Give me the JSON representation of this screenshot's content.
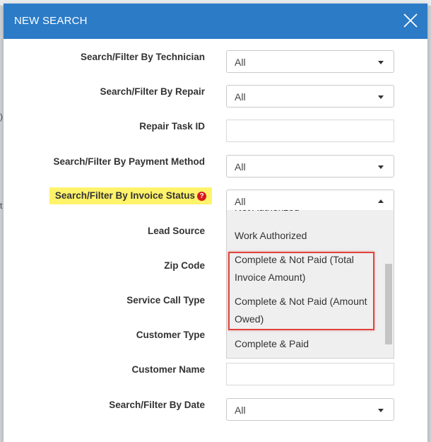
{
  "background": {
    "left_chars": [
      "):",
      "t"
    ]
  },
  "modal": {
    "title": "NEW SEARCH",
    "accent": "#2b7bc6"
  },
  "fields": [
    {
      "label": "Search/Filter By Technician",
      "type": "select",
      "value": "All"
    },
    {
      "label": "Search/Filter By Repair",
      "type": "select",
      "value": "All"
    },
    {
      "label": "Repair Task ID",
      "type": "input",
      "value": ""
    },
    {
      "label": "Search/Filter By Payment Method",
      "type": "select",
      "value": "All"
    },
    {
      "label": "Search/Filter By Invoice Status",
      "type": "select",
      "value": "All",
      "highlighted": true,
      "open": true,
      "help_icon": "question-icon"
    },
    {
      "label": "Lead Source"
    },
    {
      "label": "Zip Code"
    },
    {
      "label": "Service Call Type"
    },
    {
      "label": "Customer Type"
    },
    {
      "label": "Customer Name",
      "type": "input",
      "value": ""
    },
    {
      "label": "Search/Filter By Date",
      "type": "select",
      "value": "All"
    }
  ],
  "invoice_status_options": {
    "partial_top": "Not Authorized",
    "items": [
      "Work Authorized",
      "Complete & Not Paid (Total Invoice Amount)",
      "Complete & Not Paid (Amount Owed)",
      "Complete & Paid"
    ]
  },
  "highlight_color": "#fff36a",
  "callout_color": "#e0453f"
}
